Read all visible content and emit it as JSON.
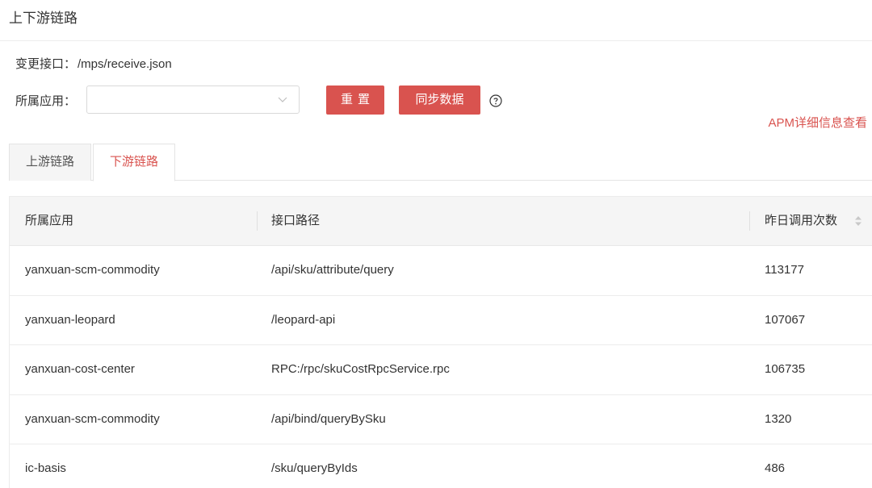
{
  "header": {
    "title": "上下游链路"
  },
  "info": {
    "label": "变更接口：",
    "value": "/mps/receive.json"
  },
  "filter": {
    "label": "所属应用：",
    "select_value": ""
  },
  "buttons": {
    "reset": "重置",
    "sync": "同步数据"
  },
  "apm_link": "APM详细信息查看",
  "tabs": [
    {
      "label": "上游链路",
      "active": false
    },
    {
      "label": "下游链路",
      "active": true
    }
  ],
  "table": {
    "columns": [
      "所属应用",
      "接口路径",
      "昨日调用次数"
    ],
    "rows": [
      {
        "app": "yanxuan-scm-commodity",
        "path": "/api/sku/attribute/query",
        "calls": "113177"
      },
      {
        "app": "yanxuan-leopard",
        "path": "/leopard-api",
        "calls": "107067"
      },
      {
        "app": "yanxuan-cost-center",
        "path": "RPC:/rpc/skuCostRpcService.rpc",
        "calls": "106735"
      },
      {
        "app": "yanxuan-scm-commodity",
        "path": "/api/bind/queryBySku",
        "calls": "1320"
      },
      {
        "app": "ic-basis",
        "path": "/sku/queryByIds",
        "calls": "486"
      }
    ]
  },
  "colors": {
    "accent": "#d9534f",
    "header_bg": "#f5f5f5",
    "border": "#ececec"
  },
  "icons": {
    "select_chevron": "chevron-down-icon",
    "help": "question-circle-icon",
    "sort": "sort-icon"
  }
}
